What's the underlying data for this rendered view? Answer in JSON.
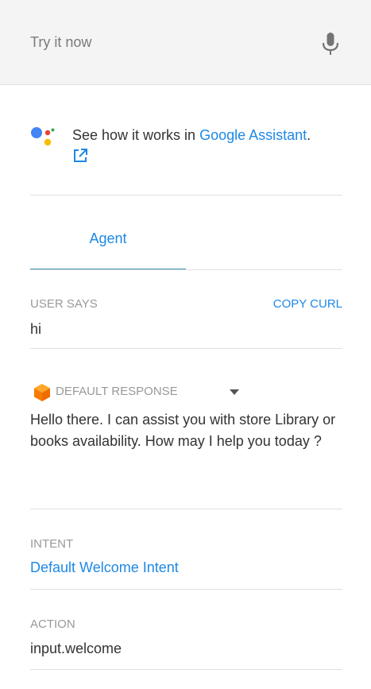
{
  "try_bar": {
    "placeholder": "Try it now",
    "mic_icon": "microphone-icon"
  },
  "assistant": {
    "prefix": "See how it works in ",
    "link": "Google Assistant",
    "suffix": "."
  },
  "tabs": [
    {
      "label": "Agent",
      "active": true
    }
  ],
  "user_says": {
    "label": "USER SAYS",
    "value": "hi",
    "copy_label": "COPY CURL"
  },
  "default_response": {
    "label": "DEFAULT RESPONSE",
    "text": "Hello there. I can assist you with store Library or books availability. How may I help you today ?"
  },
  "intent": {
    "label": "INTENT",
    "value": "Default Welcome Intent"
  },
  "action": {
    "label": "ACTION",
    "value": "input.welcome"
  },
  "colors": {
    "accent": "#1e88e5",
    "muted": "#999999",
    "cube": "#f57c00"
  }
}
